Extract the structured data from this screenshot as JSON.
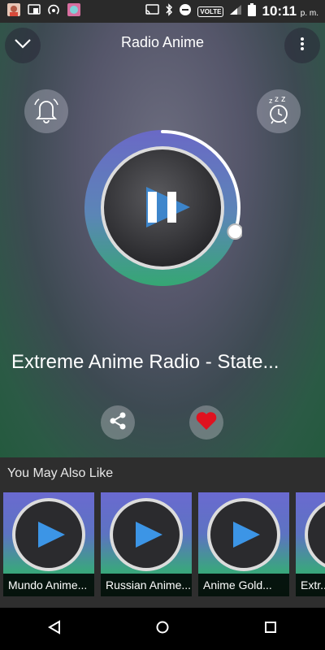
{
  "status_bar": {
    "time": "10:11",
    "ampm": "p. m.",
    "network_badge": "VOLTE",
    "left_icons": [
      "photo-thumbnail-icon",
      "cast-notification-icon",
      "hotspot-icon",
      "app-thumbnail-icon"
    ],
    "right_icons": [
      "cast-icon",
      "bluetooth-icon",
      "do-not-disturb-icon",
      "signal-icon",
      "battery-icon"
    ]
  },
  "header": {
    "title": "Radio Anime",
    "left_icon": "chevron-down-icon",
    "right_icon": "more-vert-icon"
  },
  "player": {
    "station_name": "Extreme Anime Radio - State...",
    "progress": 0.3,
    "state": "playing",
    "alarm_icon": "bell-icon",
    "sleep_icon": "sleep-timer-icon",
    "share_icon": "share-icon",
    "favorite_icon": "heart-icon",
    "favorite_color": "#e0121f",
    "progress_color": "#ffffff"
  },
  "suggestions": {
    "title": "You May Also Like",
    "items": [
      {
        "label": "Mundo Anime..."
      },
      {
        "label": "Russian Anime..."
      },
      {
        "label": "Anime Gold..."
      },
      {
        "label": "Extr..."
      }
    ]
  },
  "nav_bar": {
    "icons": [
      "back-icon",
      "home-icon",
      "recents-icon"
    ]
  }
}
